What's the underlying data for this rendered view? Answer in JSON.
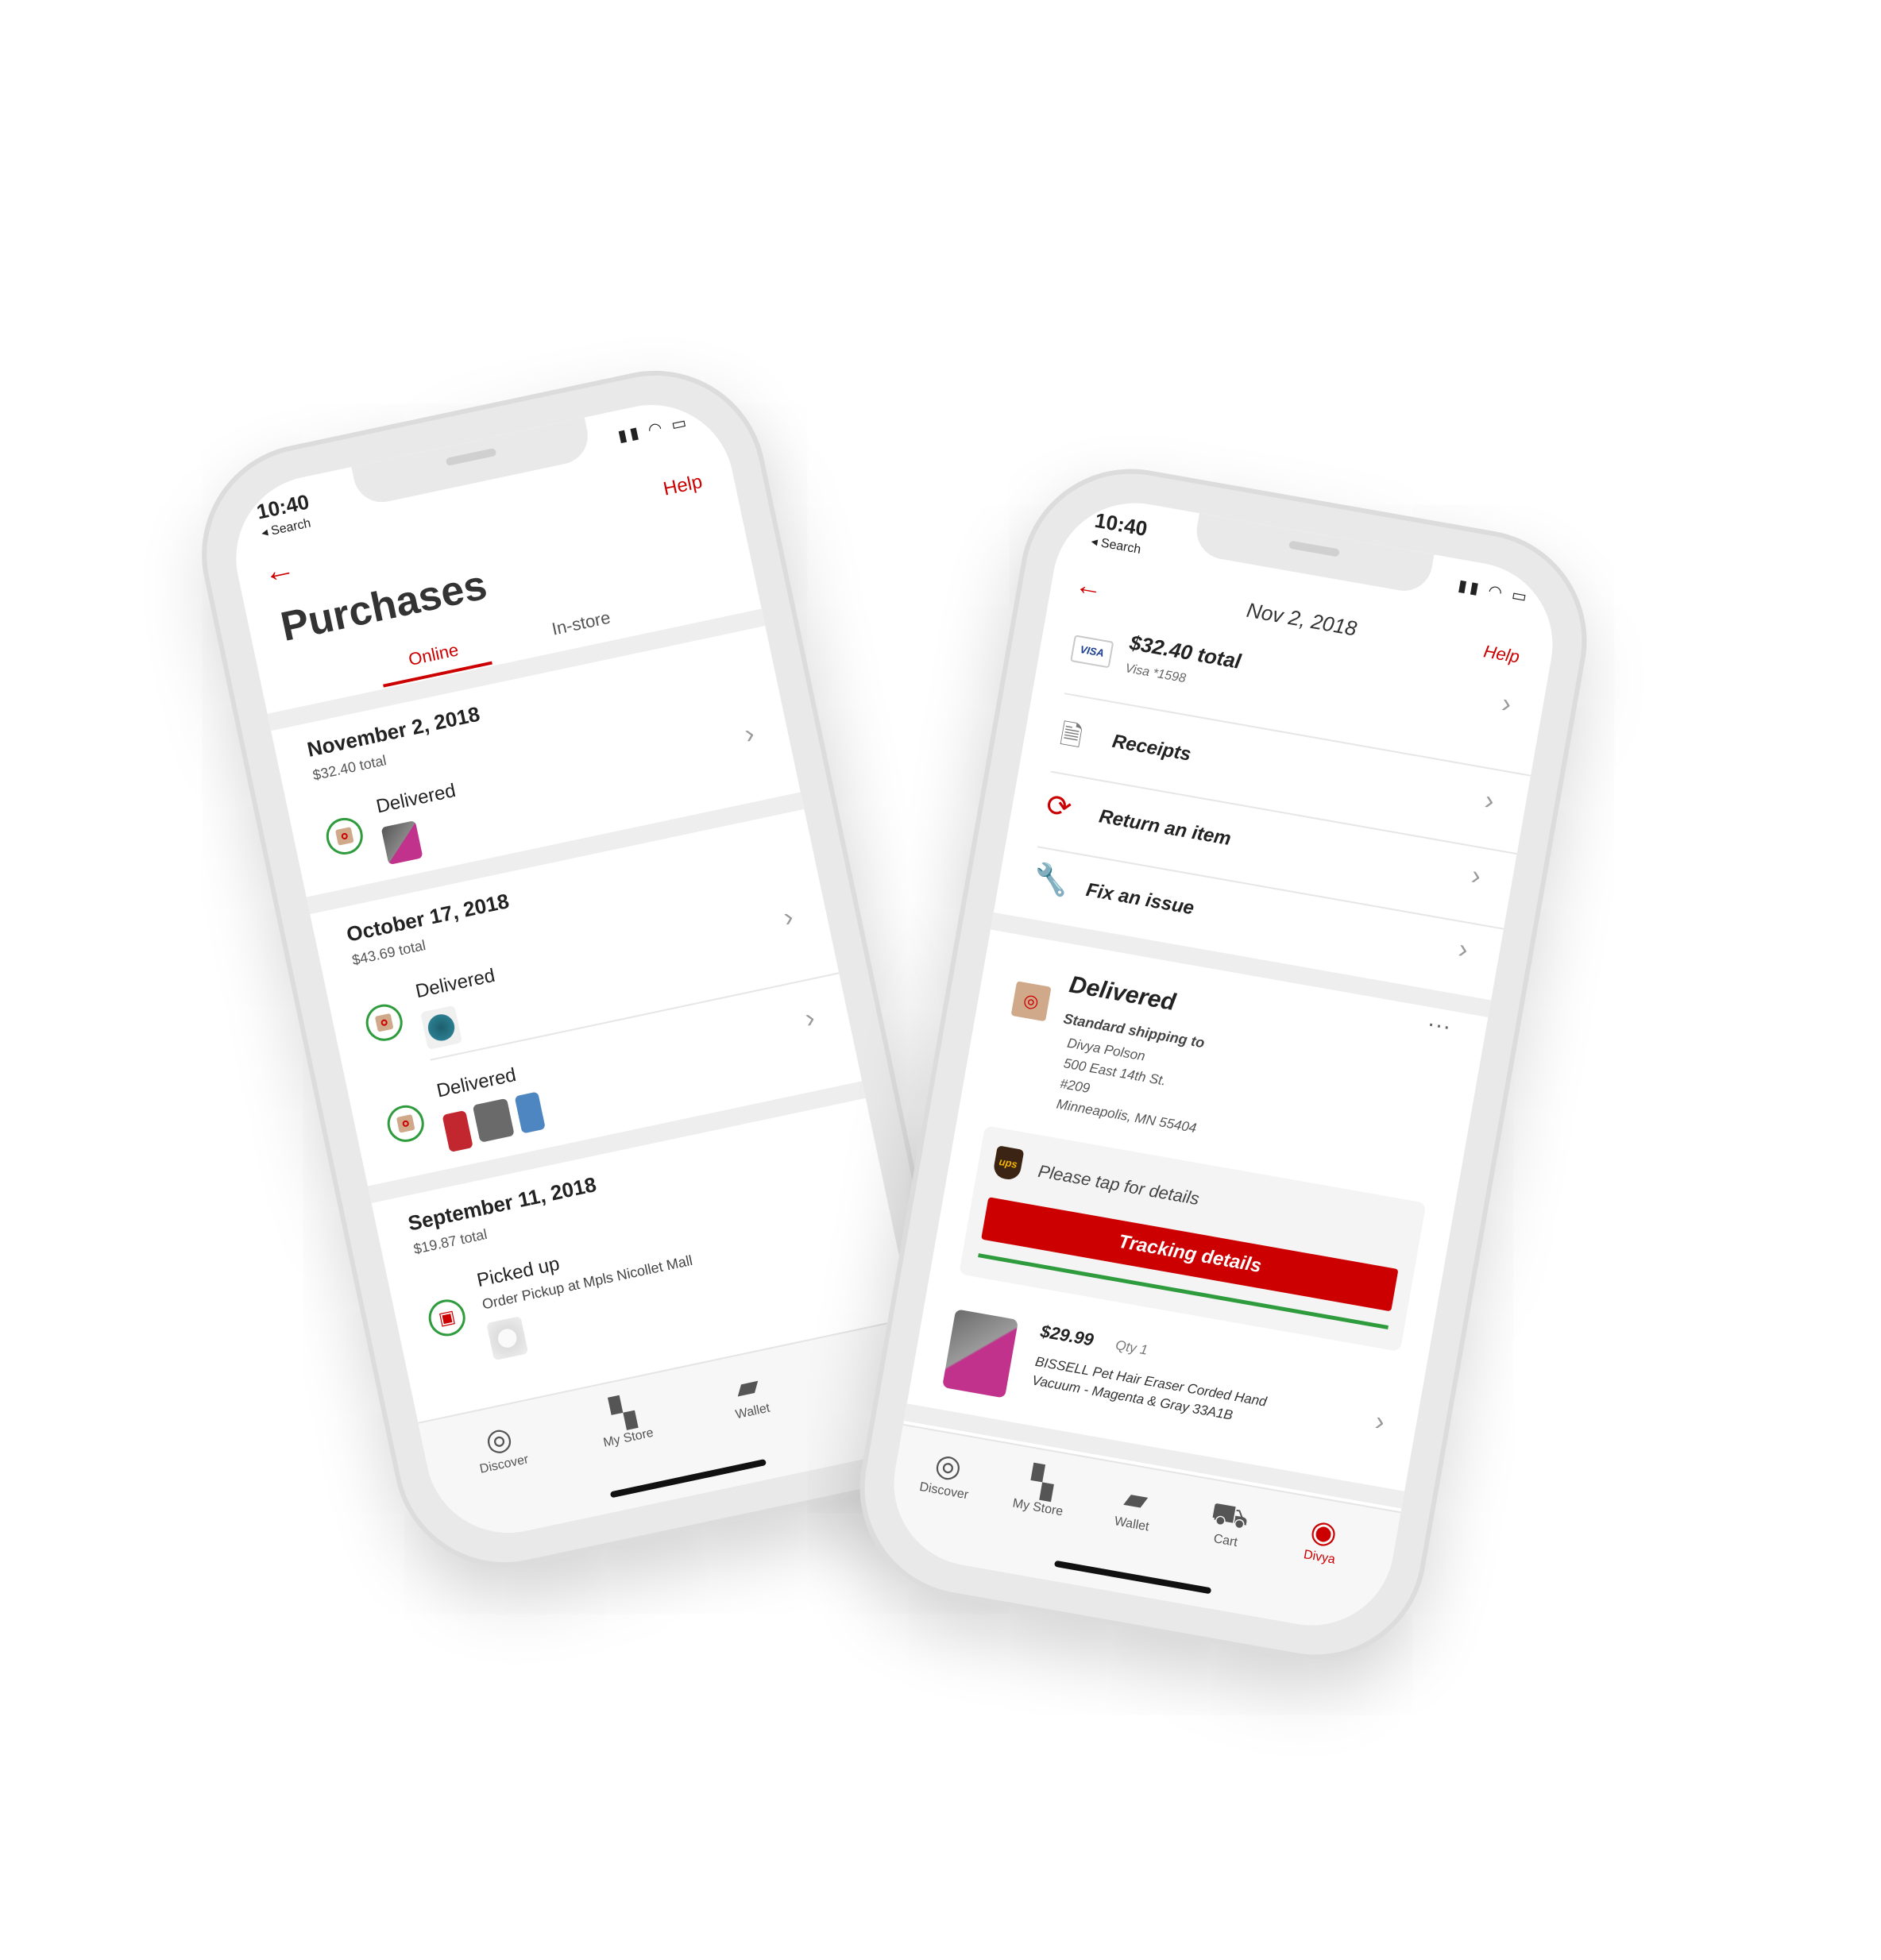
{
  "left_phone": {
    "status": {
      "time": "10:40",
      "back": "◂ Search"
    },
    "header": {
      "help": "Help",
      "title": "Purchases"
    },
    "tabs": [
      {
        "label": "Online"
      },
      {
        "label": "In-store"
      }
    ],
    "orders": [
      {
        "date": "November 2, 2018",
        "total": "$32.40 total",
        "shipments": [
          {
            "status": "Delivered"
          }
        ]
      },
      {
        "date": "October 17, 2018",
        "total": "$43.69 total",
        "shipments": [
          {
            "status": "Delivered"
          },
          {
            "status": "Delivered"
          }
        ]
      },
      {
        "date": "September 11, 2018",
        "total": "$19.87 total",
        "shipments": [
          {
            "status": "Picked up",
            "detail": "Order Pickup at Mpls Nicollet Mall"
          }
        ]
      }
    ],
    "tabbar": [
      {
        "label": "Discover",
        "icon": "target-icon"
      },
      {
        "label": "My Store",
        "icon": "store-icon"
      },
      {
        "label": "Wallet",
        "icon": "wallet-icon"
      }
    ]
  },
  "right_phone": {
    "status": {
      "time": "10:40",
      "back": "◂ Search"
    },
    "header": {
      "title": "Nov 2, 2018",
      "help": "Help"
    },
    "payment": {
      "total": "$32.40 total",
      "card_brand": "VISA",
      "card": "Visa *1598"
    },
    "actions": [
      {
        "label": "Receipts",
        "icon": "receipt-icon"
      },
      {
        "label": "Return an item",
        "icon": "return-arrows-icon"
      },
      {
        "label": "Fix an issue",
        "icon": "wrench-icon"
      }
    ],
    "delivery": {
      "status": "Delivered",
      "shipping_label": "Standard shipping to",
      "address": [
        "Divya Polson",
        "500 East 14th St.",
        "#209",
        "Minneapolis, MN 55404"
      ]
    },
    "tracking": {
      "carrier_logo": "ups",
      "prompt": "Please tap for details",
      "button": "Tracking details",
      "progress": 1.0
    },
    "item": {
      "price": "$29.99",
      "qty": "Qty 1",
      "name_line1": "BISSELL Pet Hair Eraser Corded Hand",
      "name_line2": "Vacuum - Magenta & Gray 33A1B"
    },
    "tabbar": [
      {
        "label": "Discover",
        "icon": "target-icon"
      },
      {
        "label": "My Store",
        "icon": "store-icon"
      },
      {
        "label": "Wallet",
        "icon": "wallet-icon"
      },
      {
        "label": "Cart",
        "icon": "cart-icon"
      },
      {
        "label": "Divya",
        "icon": "account-icon"
      }
    ]
  },
  "colors": {
    "accent": "#cc0000",
    "success": "#2e9b3c"
  }
}
